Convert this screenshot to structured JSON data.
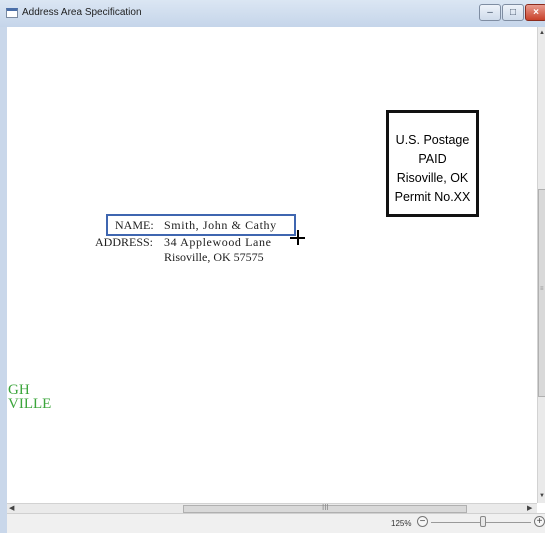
{
  "window": {
    "title": "Address Area Specification",
    "controls": {
      "minimize": "–",
      "maximize": "□",
      "close": "×"
    }
  },
  "stamp": {
    "lines": [
      "U.S. Postage",
      "PAID",
      "Risoville, OK",
      "Permit No.XX"
    ]
  },
  "address": {
    "name_label": "NAME:",
    "name_value": "Smith, John & Cathy",
    "address_label": "ADDRESS:",
    "address_line1": "34 Applewood Lane",
    "address_line2": "Risoville, OK 57575"
  },
  "partial_text": {
    "line1": "GH",
    "line2": "VILLE"
  },
  "status": {
    "zoom_level": "125%",
    "zoom_out_symbol": "−",
    "zoom_in_symbol": "+",
    "zoom_fraction": 0.5
  },
  "scrollbars": {
    "grip": "≡",
    "hgrip": "III"
  },
  "colors": {
    "name_box": "#3f66b0",
    "partial_text": "#3ba53b",
    "close_button": "#c8412a"
  }
}
